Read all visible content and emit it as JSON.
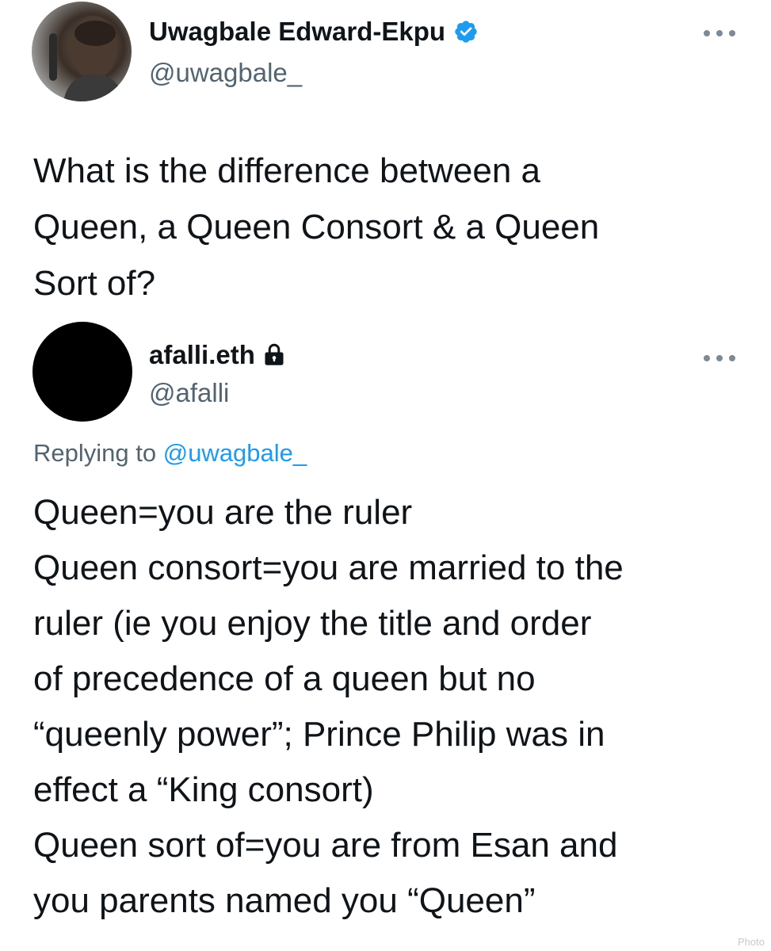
{
  "tweet": {
    "author": {
      "display_name": "Uwagbale Edward-Ekpu",
      "handle": "@uwagbale_",
      "verified": true,
      "avatar_icon": "profile-photo"
    },
    "text": "What is the difference between a\nQueen, a Queen Consort & a Queen\nSort of?"
  },
  "reply": {
    "author": {
      "display_name": "afalli.eth",
      "handle": "@afalli",
      "protected": true,
      "avatar_icon": "black-circle-avatar"
    },
    "replying_to_prefix": "Replying to",
    "replying_to_handle": "@uwagbale_",
    "text": "Queen=you are the ruler\nQueen consort=you are married to the\nruler (ie you enjoy the title and order\nof precedence of a queen but no\n“queenly power”; Prince Philip was in\neffect a “King consort)\nQueen sort of=you are from Esan and\nyou parents named you “Queen”"
  },
  "watermark": "Photo",
  "colors": {
    "text_primary": "#0f1419",
    "text_secondary": "#536471",
    "accent": "#1d9bf0",
    "more_dots": "#7c8a96"
  }
}
